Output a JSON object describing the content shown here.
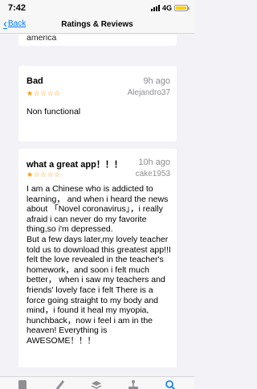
{
  "status": {
    "time": "7:42",
    "network": "4G"
  },
  "nav": {
    "back_label": "Back",
    "title": "Ratings & Reviews"
  },
  "partial_review": {
    "text": "america"
  },
  "reviews": [
    {
      "title": "Bad",
      "time": "9h ago",
      "stars": "★☆☆☆☆",
      "rating": 1,
      "author": "Alejandro37",
      "body": "Non functional"
    },
    {
      "title": "what a great app！！！",
      "time": "10h ago",
      "stars": "★☆☆☆☆",
      "rating": 1,
      "author": "cake1953",
      "body": "I am a Chinese who is addicted to learning， and when i heard the news about 「Novel coronavirus」，i really afraid i can never do my favorite thing,so i'm depressed.\nBut a few days later,my lovely teacher told us to download this greatest app!!I felt the love revealed in the teacher's homework，and soon i felt much better， when i saw my teachers and friends' lovely face i felt There is a force going straight to my body and mind，i found it heal my myopia, hunchback，now i feel i am in the heaven! Everything is AWESOME！！！"
    }
  ],
  "colors": {
    "accent": "#007aff",
    "star": "#ff9500",
    "battery": "#ffcc00"
  },
  "tabs": [
    {
      "icon": "today-icon"
    },
    {
      "icon": "games-icon"
    },
    {
      "icon": "apps-icon"
    },
    {
      "icon": "arcade-icon"
    },
    {
      "icon": "search-icon"
    }
  ]
}
